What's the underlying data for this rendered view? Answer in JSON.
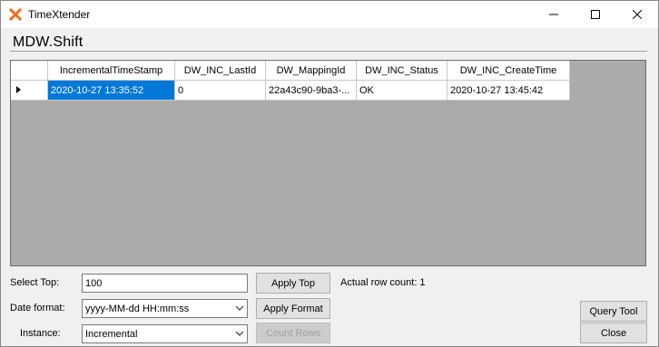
{
  "window": {
    "title": "TimeXtender"
  },
  "page_title": "MDW.Shift",
  "grid": {
    "columns": [
      "IncrementalTimeStamp",
      "DW_INC_LastId",
      "DW_MappingId",
      "DW_INC_Status",
      "DW_INC_CreateTime"
    ],
    "rows": [
      [
        "2020-10-27 13:35:52",
        "0",
        "22a43c90-9ba3-...",
        "OK",
        "2020-10-27 13:45:42"
      ]
    ]
  },
  "controls": {
    "select_top_label": "Select Top:",
    "select_top_value": "100",
    "apply_top": "Apply Top",
    "row_count_text": "Actual row count: 1",
    "date_format_label": "Date format:",
    "date_format_value": "yyyy-MM-dd HH:mm:ss",
    "apply_format": "Apply Format",
    "instance_label": "Instance:",
    "instance_value": "Incremental",
    "count_rows": "Count Rows",
    "query_tool": "Query Tool",
    "close": "Close"
  },
  "colors": {
    "accent": "#0078d7",
    "brand": "#f26b21"
  },
  "icons": {
    "app": "timextender-x-icon",
    "minimize": "minimize-icon",
    "maximize": "maximize-icon",
    "close": "close-icon"
  }
}
